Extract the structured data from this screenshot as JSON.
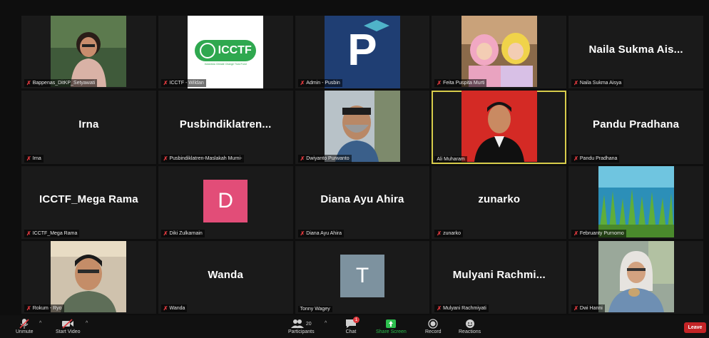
{
  "participants": [
    {
      "label": "Bappenas_DitKP_Setyawati",
      "big_name": "",
      "muted": true,
      "kind": "photo-woman"
    },
    {
      "label": "ICCTF - Wildan",
      "big_name": "",
      "muted": true,
      "kind": "logo-icctf",
      "logo_text": "ICCTF",
      "logo_sub": "Indonesia Climate Change Trust Fund"
    },
    {
      "label": "Admin - Pusbin",
      "big_name": "",
      "muted": true,
      "kind": "logo-p",
      "logo_text": "P"
    },
    {
      "label": "Feita Puspita Murti",
      "big_name": "",
      "muted": true,
      "kind": "photo-kids"
    },
    {
      "label": "Naila Sukma Aisya",
      "big_name": "Naila Sukma Ais...",
      "muted": true,
      "kind": "name"
    },
    {
      "label": "Irna",
      "big_name": "Irna",
      "muted": true,
      "kind": "name"
    },
    {
      "label": "Pusbindiklatren-Maslakah Murni-",
      "big_name": "Pusbindiklatren...",
      "muted": true,
      "kind": "name"
    },
    {
      "label": "Dwiyanto Purwanto",
      "big_name": "",
      "muted": true,
      "kind": "photo-mask"
    },
    {
      "label": "Ali Muharam",
      "big_name": "",
      "muted": false,
      "kind": "photo-red",
      "active": true
    },
    {
      "label": "Pandu Pradhana",
      "big_name": "Pandu Pradhana",
      "muted": true,
      "kind": "name"
    },
    {
      "label": "ICCTF_Mega Rama",
      "big_name": "ICCTF_Mega Rama",
      "muted": true,
      "kind": "name"
    },
    {
      "label": "Diki Zulkarnain",
      "big_name": "",
      "muted": true,
      "kind": "avatar",
      "avatar_letter": "D",
      "avatar_color": "#e24d78"
    },
    {
      "label": "Diana Ayu Ahira",
      "big_name": "Diana Ayu Ahira",
      "muted": true,
      "kind": "name"
    },
    {
      "label": "zunarko",
      "big_name": "zunarko",
      "muted": true,
      "kind": "name"
    },
    {
      "label": "Februanty Purnomo",
      "big_name": "",
      "muted": true,
      "kind": "photo-seagrass"
    },
    {
      "label": "Rokum - Ryo",
      "big_name": "",
      "muted": true,
      "kind": "photo-man-glasses"
    },
    {
      "label": "Wanda",
      "big_name": "Wanda",
      "muted": true,
      "kind": "name"
    },
    {
      "label": "Tonny Wagey",
      "big_name": "",
      "muted": false,
      "kind": "avatar",
      "avatar_letter": "T",
      "avatar_color": "#7d929f"
    },
    {
      "label": "Mulyani Rachmiyati",
      "big_name": "Mulyani  Rachmi...",
      "muted": true,
      "kind": "name"
    },
    {
      "label": "Dwi Hanni",
      "big_name": "",
      "muted": true,
      "kind": "photo-hijab"
    }
  ],
  "toolbar": {
    "unmute": "Unmute",
    "start_video": "Start Video",
    "participants": "Participants",
    "participants_count": "20",
    "chat": "Chat",
    "chat_badge": "1",
    "share_screen": "Share Screen",
    "record": "Record",
    "reactions": "Reactions",
    "leave": "Leave"
  },
  "colors": {
    "accent_green": "#2dbf4e",
    "leave_red": "#c42426",
    "active_border": "#d7cc4b",
    "mic_off_red": "#e0393e"
  }
}
